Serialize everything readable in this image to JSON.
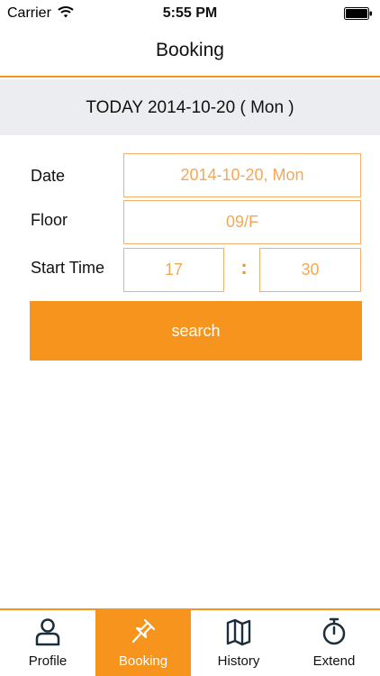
{
  "status_bar": {
    "carrier": "Carrier",
    "time": "5:55 PM",
    "wifi_icon": "wifi-icon",
    "battery_icon": "battery-icon"
  },
  "nav": {
    "title": "Booking"
  },
  "today": {
    "text": "TODAY 2014-10-20 ( Mon )"
  },
  "form": {
    "date_label": "Date",
    "date_value": "2014-10-20, Mon",
    "floor_label": "Floor",
    "floor_value": "09/F",
    "start_time_label": "Start Time",
    "hour_value": "17",
    "separator": ":",
    "minute_value": "30"
  },
  "search": {
    "label": "search"
  },
  "tabs": [
    {
      "label": "Profile",
      "icon": "person-icon",
      "active": false
    },
    {
      "label": "Booking",
      "icon": "pin-icon",
      "active": true
    },
    {
      "label": "History",
      "icon": "map-icon",
      "active": false
    },
    {
      "label": "Extend",
      "icon": "stopwatch-icon",
      "active": false
    }
  ],
  "colors": {
    "accent": "#f7941d",
    "field_text": "#f3a857",
    "field_border": "#f5b16b",
    "band": "#ecedf1"
  }
}
